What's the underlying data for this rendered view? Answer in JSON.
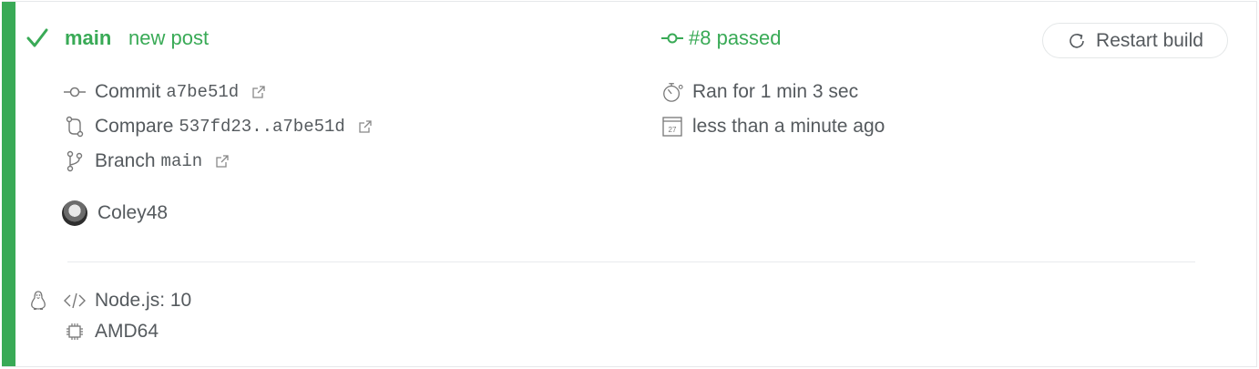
{
  "header": {
    "branch": "main",
    "commit_message": "new post",
    "build_status": "#8 passed",
    "restart_label": "Restart build"
  },
  "details": {
    "commit_label": "Commit",
    "commit_sha": "a7be51d",
    "compare_label": "Compare",
    "compare_range": "537fd23..a7be51d",
    "branch_label": "Branch",
    "branch_value": "main",
    "duration": "Ran for 1 min 3 sec",
    "finished": "less than a minute ago",
    "calendar_day": "27"
  },
  "author": {
    "name": "Coley48"
  },
  "environment": {
    "language": "Node.js: 10",
    "arch": "AMD64"
  },
  "colors": {
    "passed": "#39aa56",
    "text": "#555a5e"
  },
  "icons": [
    "check-icon",
    "commit-icon",
    "compare-icon",
    "branch-icon",
    "external-link-icon",
    "stopwatch-icon",
    "calendar-icon",
    "restart-icon",
    "linux-icon",
    "code-icon",
    "cpu-icon"
  ]
}
